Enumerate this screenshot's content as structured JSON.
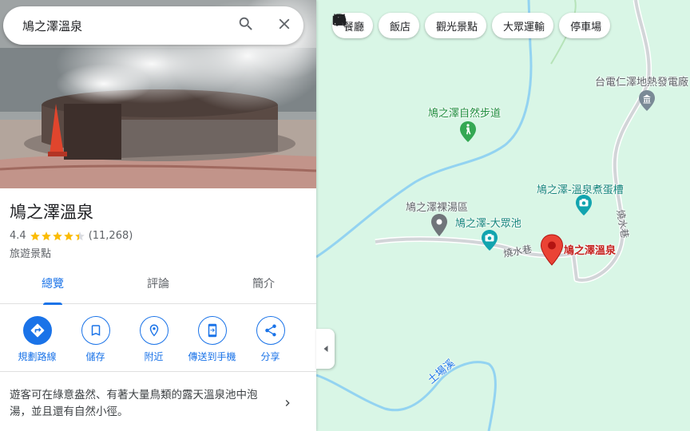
{
  "search": {
    "value": "鳩之澤溫泉"
  },
  "place": {
    "title": "鳩之澤溫泉",
    "rating": "4.4",
    "stars": 4.4,
    "reviews": "(11,268)",
    "category": "旅遊景點",
    "description": "遊客可在綠意盎然、有著大量鳥類的露天溫泉池中泡湯，並且還有自然小徑。"
  },
  "tabs": [
    {
      "label": "總覽",
      "active": true
    },
    {
      "label": "評論"
    },
    {
      "label": "簡介"
    }
  ],
  "actions": [
    {
      "label": "規劃路線",
      "icon": "directions-icon"
    },
    {
      "label": "儲存",
      "icon": "bookmark-icon"
    },
    {
      "label": "附近",
      "icon": "nearby-icon"
    },
    {
      "label": "傳送到手機",
      "icon": "send-to-phone-icon"
    },
    {
      "label": "分享",
      "icon": "share-icon"
    }
  ],
  "chips": [
    {
      "label": "餐廳",
      "icon": "restaurant-icon"
    },
    {
      "label": "飯店",
      "icon": "hotel-icon"
    },
    {
      "label": "觀光景點",
      "icon": "camera-icon"
    },
    {
      "label": "大眾運輸",
      "icon": "transit-icon"
    },
    {
      "label": "停車場",
      "icon": "parking-icon"
    }
  ],
  "map_labels": {
    "power_plant": "台電仁澤地熱發電廠",
    "trail": "鳩之澤自然步道",
    "egg_pool": "鳩之澤-溫泉煮蛋槽",
    "nude_area": "鳩之澤裸湯區",
    "public_pool": "鳩之澤-大眾池",
    "destination": "鳩之澤溫泉",
    "alley_1": "燒水巷",
    "alley_2": "燒水巷",
    "river": "土場溪"
  },
  "colors": {
    "accent": "#1a73e8",
    "star": "#fbbc04",
    "map_bg": "#d9f6e6",
    "river": "#8ed0f0",
    "pin_red": "#ea4335"
  }
}
